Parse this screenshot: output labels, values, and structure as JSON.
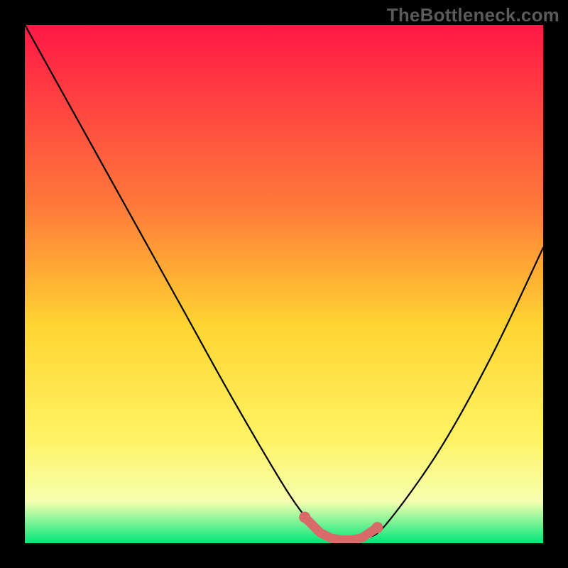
{
  "watermark": "TheBottleneck.com",
  "colors": {
    "gradient_top": "#ff1846",
    "gradient_mid1": "#ff7a3a",
    "gradient_mid2": "#ffd531",
    "gradient_mid3": "#fff365",
    "gradient_mid4": "#f6ffb0",
    "gradient_bottom": "#00e67a",
    "curve": "#000000",
    "highlight": "#d86a6a"
  },
  "chart_data": {
    "type": "line",
    "title": "",
    "xlabel": "",
    "ylabel": "",
    "xlim": [
      0,
      100
    ],
    "ylim": [
      0,
      100
    ],
    "series": [
      {
        "name": "bottleneck-curve",
        "x": [
          0,
          10,
          20,
          30,
          40,
          50,
          55,
          58,
          62,
          66,
          70,
          80,
          90,
          100
        ],
        "y": [
          100,
          82,
          64,
          46,
          28,
          11,
          4,
          1,
          0.5,
          1,
          4,
          18,
          36,
          57
        ]
      }
    ],
    "highlight": {
      "name": "zero-bottleneck-band",
      "x_range": [
        54,
        68
      ],
      "markers": [
        {
          "x": 54,
          "y": 5
        },
        {
          "x": 57,
          "y": 2
        },
        {
          "x": 59,
          "y": 1
        },
        {
          "x": 61,
          "y": 0.6
        },
        {
          "x": 63,
          "y": 0.6
        },
        {
          "x": 65,
          "y": 1
        },
        {
          "x": 68,
          "y": 3
        }
      ]
    }
  }
}
